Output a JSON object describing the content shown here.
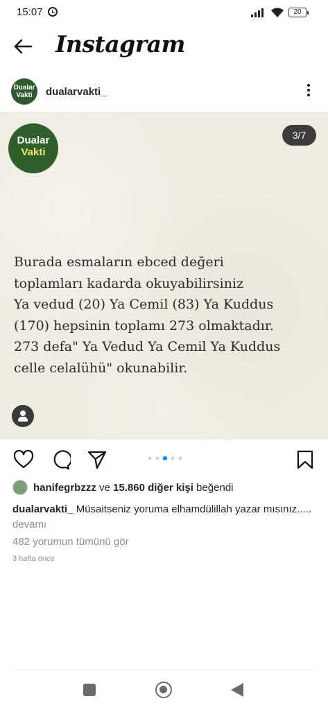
{
  "status_bar": {
    "time": "15:07",
    "battery": "20",
    "icons": [
      "alarm-icon",
      "signal-icon",
      "wifi-icon",
      "battery-icon"
    ]
  },
  "header": {
    "title": "Instagram",
    "back_icon": "arrow-left-icon"
  },
  "post": {
    "avatar_text": [
      "Dualar",
      "Vakti"
    ],
    "username": "dualarvakti_",
    "more_icon": "more-vertical-icon",
    "image": {
      "logo_line1": "Dualar",
      "logo_line2": "Vakti",
      "counter": "3/7",
      "text_lines": [
        "Burada esmaların ebced değeri",
        "toplamları kadarda okuyabilirsiniz",
        "Ya vedud (20) Ya Cemil (83) Ya Kuddus",
        "(170) hepsinin toplamı 273 olmaktadır.",
        "273 defa\" Ya Vedud Ya Cemil Ya Kuddus",
        "celle celalühü\" okunabilir."
      ],
      "tag_icon": "user-tag-icon"
    },
    "actions": {
      "like_icon": "heart-icon",
      "comment_icon": "comment-icon",
      "share_icon": "send-icon",
      "save_icon": "bookmark-icon",
      "carousel_total": 5,
      "carousel_active": 3
    },
    "likes": {
      "user": "hanifegrbzzz",
      "connector": " ve ",
      "count_text": "15.860 diğer kişi",
      "suffix": " beğendi"
    },
    "caption": {
      "user": "dualarvakti_",
      "text": " Müsaitseniz yoruma elhamdülillah yazar mısınız.....",
      "more": " devamı"
    },
    "comments_link": "482 yorumun tümünü gör",
    "time_ago": "3 hafta önce"
  },
  "nav_bar": {
    "icons": [
      "recents-square-icon",
      "home-circle-icon",
      "back-triangle-icon"
    ]
  },
  "colors": {
    "accent_green": "#2f5f2a",
    "logo_yellow": "#f1e76a",
    "active_dot": "#0095f6",
    "muted_text": "#8e8e8e"
  }
}
